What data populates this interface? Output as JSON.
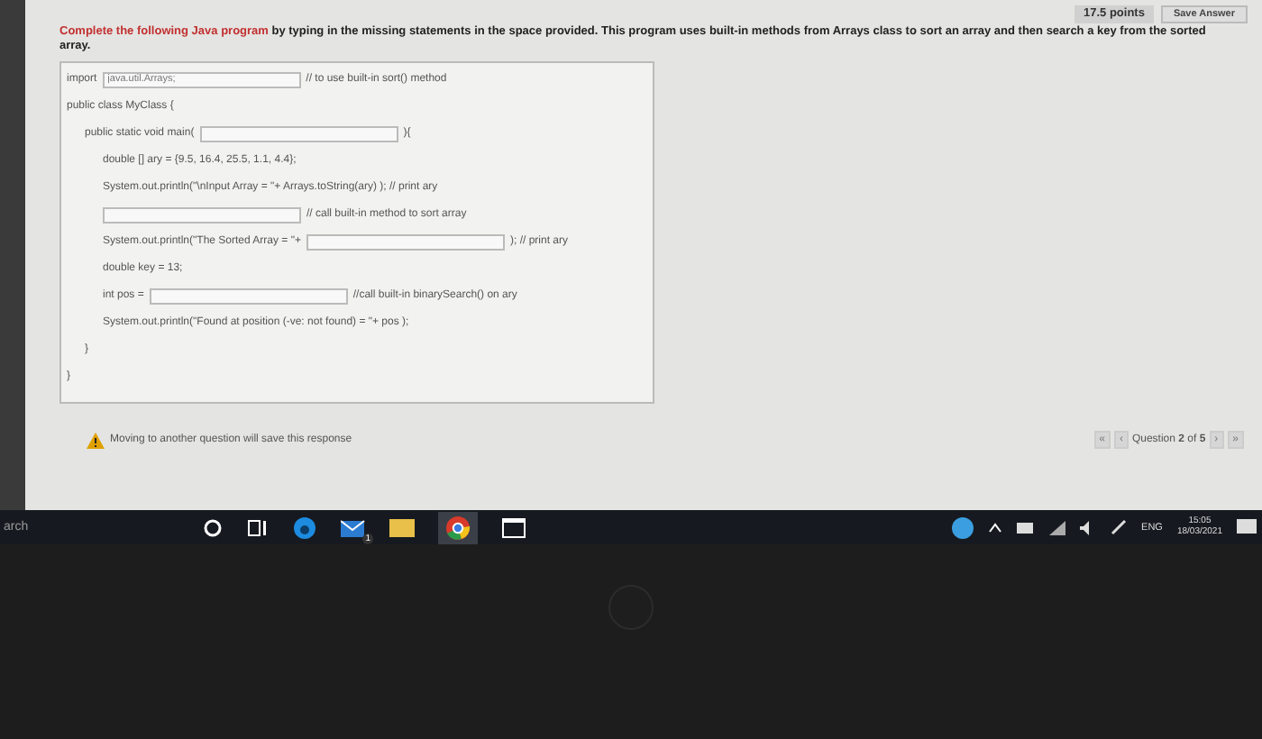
{
  "header": {
    "points": "17.5 points",
    "save_button": "Save Answer"
  },
  "instruction": {
    "highlight": "Complete the following Java program",
    "text": " by typing in the missing statements in the space provided. This program uses built-in methods from Arrays class to sort an array and then search a key from the sorted array."
  },
  "code": [
    {
      "segments": [
        {
          "kind": "text",
          "text": "import"
        },
        {
          "kind": "field",
          "value": "java.util.Arrays;"
        },
        {
          "kind": "text",
          "text": "// to use built-in sort() method"
        }
      ]
    },
    {
      "segments": [
        {
          "kind": "text",
          "text": "public class MyClass {"
        }
      ],
      "children": [
        {
          "segments": [
            {
              "kind": "text",
              "text": "public static void main("
            },
            {
              "kind": "field"
            },
            {
              "kind": "text",
              "text": "){"
            }
          ],
          "children": [
            {
              "segments": [
                {
                  "kind": "text",
                  "text": "double [] ary = {9.5, 16.4, 25.5, 1.1, 4.4};"
                }
              ]
            },
            {
              "segments": [
                {
                  "kind": "text",
                  "text": "System.out.println(\"\\nInput Array = \"+ Arrays.toString(ary) ); // print ary"
                }
              ]
            },
            {
              "segments": [
                {
                  "kind": "field"
                },
                {
                  "kind": "text",
                  "text": "// call built-in method to sort array"
                }
              ]
            },
            {
              "segments": [
                {
                  "kind": "text",
                  "text": "System.out.println(\"The Sorted Array = \"+"
                },
                {
                  "kind": "field"
                },
                {
                  "kind": "text",
                  "text": "); // print ary"
                }
              ]
            },
            {
              "segments": [
                {
                  "kind": "text",
                  "text": "double key = 13;"
                }
              ]
            },
            {
              "segments": [
                {
                  "kind": "text",
                  "text": "int pos ="
                },
                {
                  "kind": "field"
                },
                {
                  "kind": "text",
                  "text": "//call built-in binarySearch() on ary"
                }
              ]
            },
            {
              "segments": [
                {
                  "kind": "text",
                  "text": "System.out.println(\"Found at position (-ve: not found) = \"+ pos );"
                }
              ]
            }
          ]
        },
        {
          "segments": [
            {
              "kind": "text",
              "text": "}"
            }
          ]
        }
      ]
    },
    {
      "segments": [
        {
          "kind": "text",
          "text": "}"
        }
      ]
    }
  ],
  "footer": {
    "warning": "Moving to another question will save this response",
    "nav_first": "«",
    "nav_prev": "‹",
    "question": "Question **2** of **5**",
    "nav_next": "›",
    "nav_last": "»"
  },
  "taskbar": {
    "search": "arch",
    "mail_badge": "1",
    "language": "ENG",
    "time": "15:05",
    "date": "18/03/2021"
  }
}
